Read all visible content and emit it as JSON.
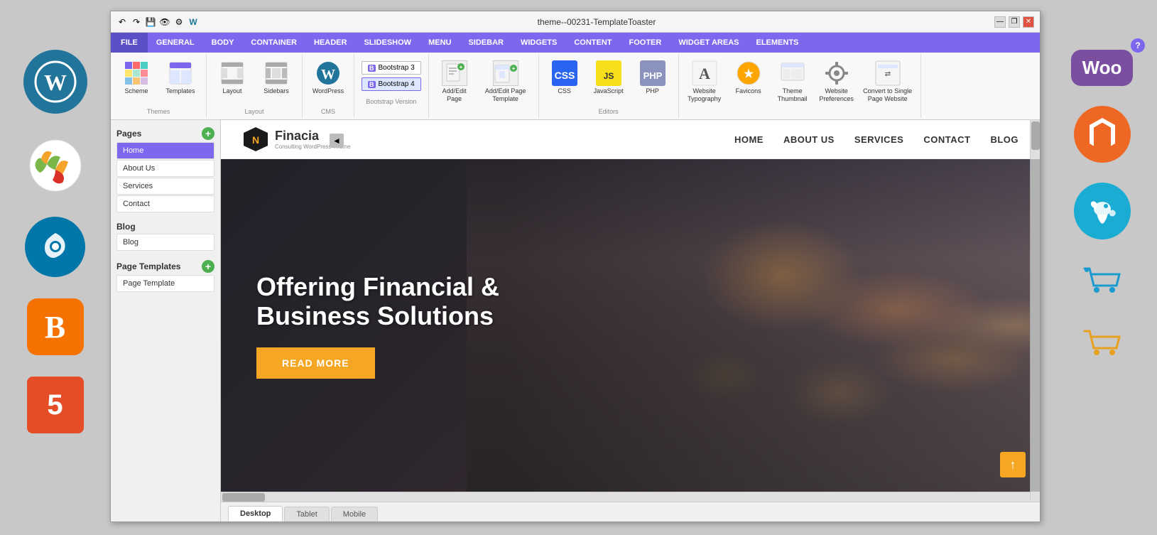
{
  "window": {
    "title": "theme--00231-TemplateToaster",
    "min_btn": "—",
    "restore_btn": "❐",
    "close_btn": "✕"
  },
  "menu": {
    "items": [
      {
        "label": "FILE",
        "active": true
      },
      {
        "label": "GENERAL"
      },
      {
        "label": "BODY"
      },
      {
        "label": "CONTAINER"
      },
      {
        "label": "HEADER"
      },
      {
        "label": "SLIDESHOW"
      },
      {
        "label": "MENU"
      },
      {
        "label": "SIDEBAR"
      },
      {
        "label": "WIDGETS"
      },
      {
        "label": "CONTENT"
      },
      {
        "label": "FOOTER"
      },
      {
        "label": "WIDGET AREAS"
      },
      {
        "label": "ELEMENTS"
      }
    ]
  },
  "ribbon": {
    "groups": [
      {
        "label": "Themes",
        "items": [
          {
            "id": "scheme",
            "label": "Scheme"
          },
          {
            "id": "templates",
            "label": "Templates"
          }
        ]
      },
      {
        "label": "Layout",
        "items": [
          {
            "id": "layout",
            "label": "Layout"
          },
          {
            "id": "sidebars",
            "label": "Sidebars"
          }
        ]
      },
      {
        "label": "CMS",
        "items": [
          {
            "id": "wordpress",
            "label": "WordPress"
          }
        ]
      },
      {
        "label": "Bootstrap Version",
        "items": [
          {
            "id": "bootstrap3",
            "label": "Bootstrap 3"
          },
          {
            "id": "bootstrap4",
            "label": "Bootstrap 4",
            "active": true
          }
        ]
      },
      {
        "label": "",
        "items": [
          {
            "id": "add-edit-page",
            "label": "Add/Edit Page"
          },
          {
            "id": "add-edit-template",
            "label": "Add/Edit Page Template"
          }
        ]
      },
      {
        "label": "Editors",
        "items": [
          {
            "id": "css",
            "label": "CSS"
          },
          {
            "id": "javascript",
            "label": "JavaScript"
          },
          {
            "id": "php",
            "label": "PHP"
          }
        ]
      },
      {
        "label": "",
        "items": [
          {
            "id": "website-typography",
            "label": "Website Typography"
          },
          {
            "id": "favicons",
            "label": "Favicons"
          },
          {
            "id": "theme-thumbnail",
            "label": "Theme Thumbnail"
          },
          {
            "id": "website-preferences",
            "label": "Website Preferences"
          },
          {
            "id": "convert",
            "label": "Convert to Single Page Website"
          }
        ]
      }
    ]
  },
  "sidebar": {
    "collapse_btn": "◄",
    "pages_section": {
      "label": "Pages",
      "add_btn": "+",
      "items": [
        {
          "label": "Home",
          "active": true
        },
        {
          "label": "About Us"
        },
        {
          "label": "Services"
        },
        {
          "label": "Contact"
        }
      ]
    },
    "blog_section": {
      "label": "Blog",
      "items": [
        {
          "label": "Blog"
        }
      ]
    },
    "page_templates_section": {
      "label": "Page Templates",
      "add_btn": "+",
      "items": [
        {
          "label": "Page Template"
        }
      ]
    }
  },
  "website": {
    "logo": {
      "name": "Finacia",
      "tagline": "Consulting WordPress Theme"
    },
    "nav_items": [
      "HOME",
      "ABOUT US",
      "SERVICES",
      "CONTACT",
      "BLOG"
    ],
    "hero": {
      "title_line1": "Offering Financial &",
      "title_line2": "Business Solutions",
      "cta_label": "READ MORE"
    }
  },
  "view_tabs": {
    "tabs": [
      {
        "label": "Desktop",
        "active": true
      },
      {
        "label": "Tablet"
      },
      {
        "label": "Mobile"
      }
    ]
  },
  "side_icons_left": [
    {
      "id": "wordpress",
      "label": "W"
    },
    {
      "id": "joomla",
      "label": "Joomla"
    },
    {
      "id": "drupal",
      "label": "Drupal"
    },
    {
      "id": "blogger",
      "label": "B"
    },
    {
      "id": "html5",
      "label": "5"
    }
  ],
  "side_icons_right": [
    {
      "id": "woo",
      "label": "Woo"
    },
    {
      "id": "magento",
      "label": "M"
    },
    {
      "id": "opencart",
      "label": "OpenCart"
    },
    {
      "id": "cart2",
      "label": "🛒"
    },
    {
      "id": "cart3",
      "label": "🛒"
    }
  ],
  "info_btn": "?"
}
